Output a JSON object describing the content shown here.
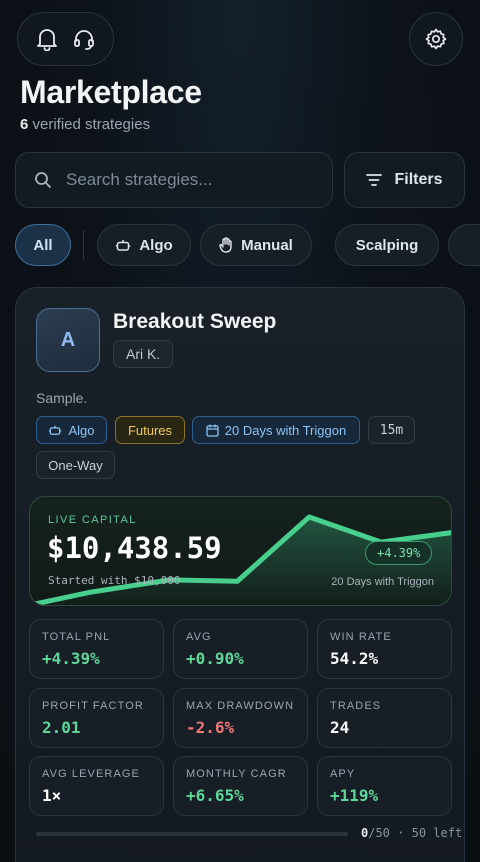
{
  "header": {
    "bell_icon": "bell-icon",
    "support_icon": "headset-icon",
    "settings_icon": "gear-icon",
    "title": "Marketplace",
    "count": "6",
    "count_suffix": " verified strategies"
  },
  "search": {
    "placeholder": "Search strategies..."
  },
  "filters": {
    "label": "Filters"
  },
  "chips": [
    {
      "label": "All",
      "active": true
    },
    {
      "label": "Algo",
      "icon": "robot-icon"
    },
    {
      "label": "Manual",
      "icon": "hand-icon"
    },
    {
      "label": "Scalping"
    }
  ],
  "card": {
    "avatar_letter": "A",
    "name": "Breakout Sweep",
    "author": "Ari K.",
    "description": "Sample.",
    "tags": {
      "algo": "Algo",
      "futures": "Futures",
      "days": "20 Days with Triggon",
      "timeframe": "15m",
      "mode": "One-Way"
    },
    "capital": {
      "label": "LIVE CAPITAL",
      "value": "$10,438.59",
      "started": "Started with $10,000",
      "badge": "+4.39%",
      "days": "20 Days with Triggon",
      "spark": [
        0,
        9,
        18,
        17,
        63,
        45,
        52
      ]
    },
    "stats": {
      "total_pnl": {
        "label": "TOTAL PNL",
        "value": "+4.39%"
      },
      "avg": {
        "label": "AVG",
        "value": "+0.90%"
      },
      "win_rate": {
        "label": "WIN RATE",
        "value": "54.2%"
      },
      "profit_factor": {
        "label": "PROFIT FACTOR",
        "value": "2.01"
      },
      "max_drawdown": {
        "label": "MAX DRAWDOWN",
        "value": "-2.6%"
      },
      "trades": {
        "label": "TRADES",
        "value": "24"
      },
      "avg_leverage": {
        "label": "AVG LEVERAGE",
        "value": "1×"
      },
      "monthly_cagr": {
        "label": "MONTHLY CAGR",
        "value": "+6.65%"
      },
      "apy": {
        "label": "APY",
        "value": "+119%"
      }
    },
    "slots": {
      "filled": "0",
      "total": "/50",
      "separator": "·",
      "left": "50 left",
      "fraction": 0
    }
  },
  "colors": {
    "accent": "#5ed69a",
    "negative": "#f07878",
    "active_chip": "#1a3148",
    "gold": "#f0ca58"
  }
}
